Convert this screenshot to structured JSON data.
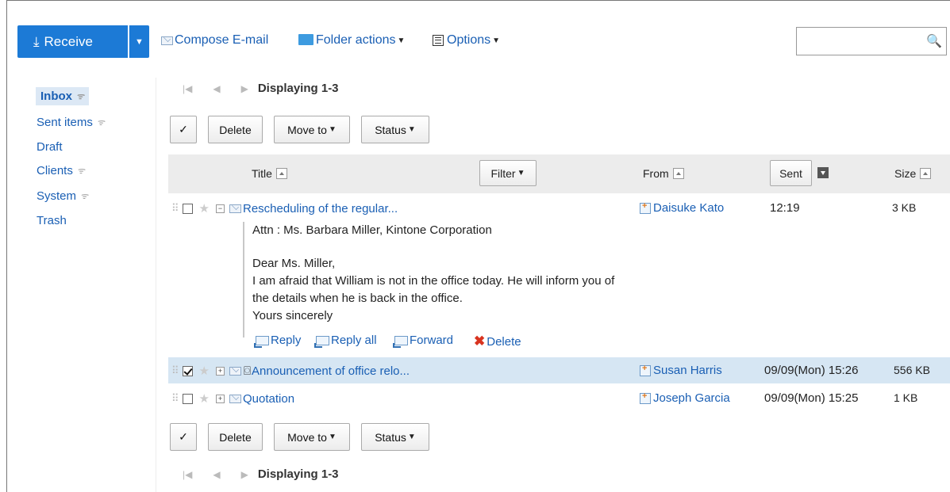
{
  "header": {
    "receive_label": "Receive",
    "compose_label": "Compose E-mail",
    "folder_actions_label": "Folder actions",
    "options_label": "Options",
    "search_value": ""
  },
  "sidebar": {
    "items": [
      {
        "label": "Inbox",
        "rss": true,
        "active": true
      },
      {
        "label": "Sent items",
        "rss": true
      },
      {
        "label": "Draft",
        "rss": false
      },
      {
        "label": "Clients",
        "rss": true
      },
      {
        "label": "System",
        "rss": true
      },
      {
        "label": "Trash",
        "rss": false
      }
    ]
  },
  "pager": {
    "text": "Displaying 1-3"
  },
  "toolbar": {
    "check_label": "✓",
    "delete_label": "Delete",
    "move_label": "Move to",
    "status_label": "Status"
  },
  "table": {
    "headers": {
      "title": "Title",
      "filter": "Filter",
      "from": "From",
      "sent": "Sent",
      "size": "Size"
    },
    "rows": [
      {
        "checked": false,
        "expanded": true,
        "attachment": false,
        "title": "Rescheduling of the regular...",
        "from": "Daisuke Kato",
        "sent": "12:19",
        "size": "3 KB",
        "selected": false
      },
      {
        "checked": true,
        "expanded": false,
        "attachment": true,
        "title": "Announcement of office relo...",
        "from": "Susan Harris",
        "sent": "09/09(Mon) 15:26",
        "size": "556 KB",
        "selected": true
      },
      {
        "checked": false,
        "expanded": false,
        "attachment": false,
        "title": "Quotation",
        "from": "Joseph Garcia",
        "sent": "09/09(Mon) 15:25",
        "size": "1 KB",
        "selected": false
      }
    ]
  },
  "preview": {
    "lines": [
      "Attn : Ms. Barbara Miller, Kintone Corporation",
      "",
      "Dear Ms. Miller,",
      "I am afraid that William is not in the office today. He will inform you of",
      "the details when he is back in the office.",
      "Yours sincerely"
    ],
    "actions": {
      "reply": "Reply",
      "reply_all": "Reply all",
      "forward": "Forward",
      "delete": "Delete"
    }
  },
  "colors": {
    "accent": "#1c7ad6",
    "link": "#1a5fb4",
    "selected_row": "#d6e6f3",
    "delete_red": "#d8331f"
  }
}
